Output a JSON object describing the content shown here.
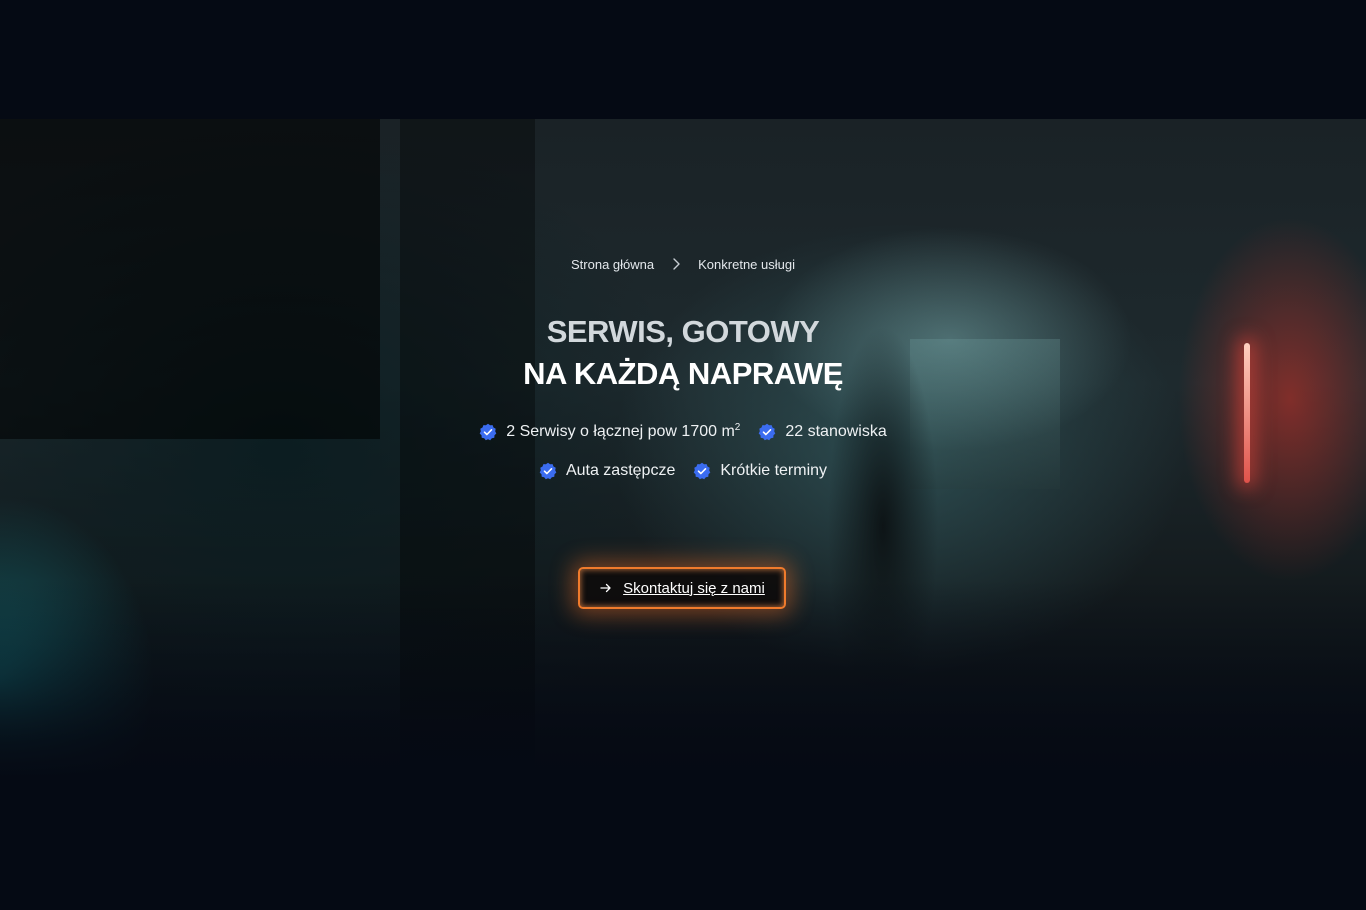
{
  "breadcrumb": {
    "home": "Strona główna",
    "current": "Konkretne usługi"
  },
  "hero": {
    "title_line1": "SERWIS, GOTOWY",
    "title_line2": "NA KAŻDĄ NAPRAWĘ",
    "features": [
      {
        "text": "2 Serwisy o łącznej pow 1700 m",
        "sup": "2",
        "icon": "verified-badge-icon"
      },
      {
        "text": "22 stanowiska",
        "icon": "verified-badge-icon"
      },
      {
        "text": "Auta zastępcze",
        "icon": "verified-badge-icon"
      },
      {
        "text": "Krótkie terminy",
        "icon": "verified-badge-icon"
      }
    ],
    "cta": {
      "label": "Skontaktuj się z nami",
      "icon": "arrow-right-icon"
    }
  },
  "colors": {
    "background": "#050a14",
    "accent": "#f07b2c",
    "badge": "#3b6cf0"
  }
}
